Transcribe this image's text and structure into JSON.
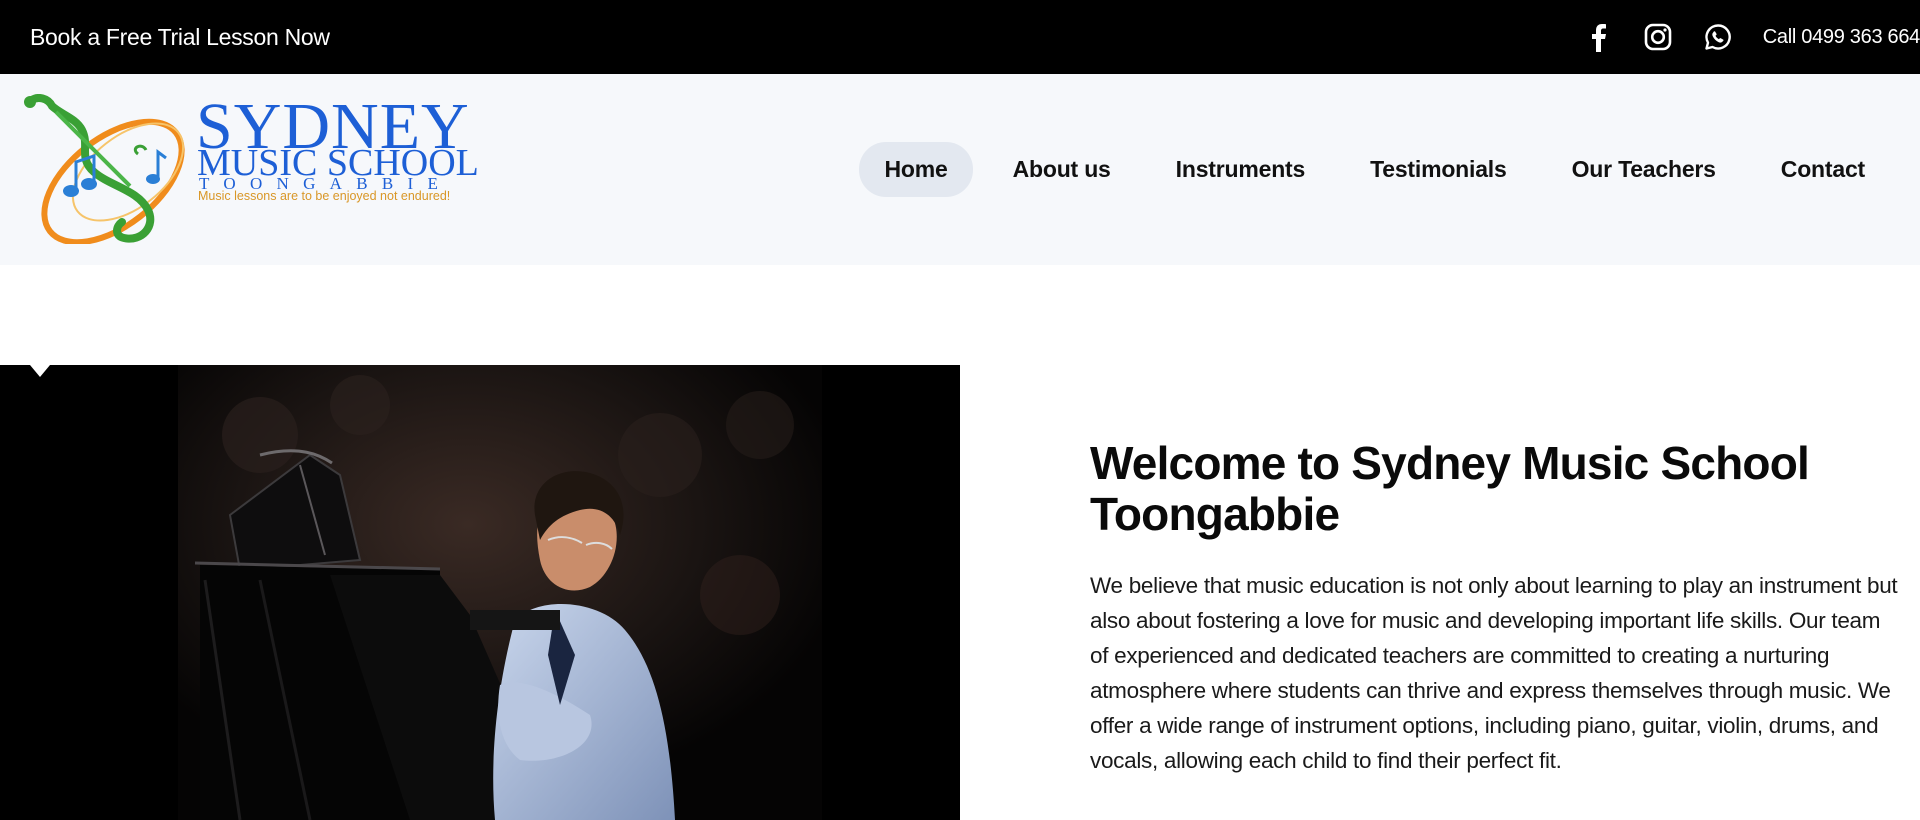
{
  "topbar": {
    "promo_label": "Book a Free Trial Lesson Now",
    "social_icons": [
      "facebook-icon",
      "instagram-icon",
      "whatsapp-icon"
    ],
    "phone_label": "Call 0499 363 664"
  },
  "logo": {
    "line1": "SYDNEY",
    "line2": "MUSIC SCHOOL",
    "line3": "TOONGABBIE",
    "tagline": "Music lessons are to be enjoyed not endured!"
  },
  "nav": {
    "items": [
      {
        "label": "Home",
        "active": true
      },
      {
        "label": "About us",
        "active": false
      },
      {
        "label": "Instruments",
        "active": false
      },
      {
        "label": "Testimonials",
        "active": false
      },
      {
        "label": "Our Teachers",
        "active": false
      },
      {
        "label": "Contact",
        "active": false
      }
    ]
  },
  "welcome": {
    "heading_line1": "Welcome to Sydney Music School",
    "heading_line2": "Toongabbie",
    "body": "We believe that music education is not only about learning to play an instrument but also about fostering a love for music and developing important life skills. Our team of experienced and dedicated teachers are committed to creating a nurturing atmosphere where students can thrive and express themselves through music. We offer a wide range of instrument options, including piano, guitar, violin, drums, and vocals, allowing each child to find their perfect fit."
  },
  "colors": {
    "topbar_bg": "#000000",
    "header_bg": "#f6f8fb",
    "logo_blue": "#1d5fd6",
    "logo_orange": "#f08c1c",
    "logo_green": "#3aa035",
    "nav_active_bg": "#e3e8f0"
  }
}
